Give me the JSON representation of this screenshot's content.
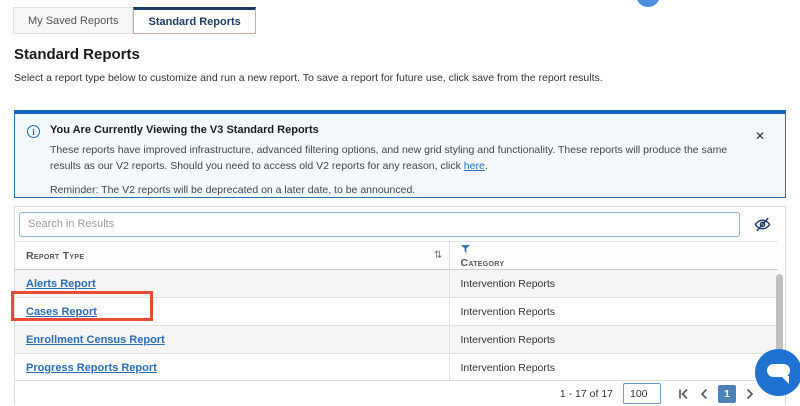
{
  "tabs": [
    {
      "label": "My Saved Reports",
      "active": false
    },
    {
      "label": "Standard Reports",
      "active": true
    }
  ],
  "heading": "Standard Reports",
  "description": "Select a report type below to customize and run a new report. To save a report for future use, click save from the report results.",
  "banner": {
    "title": "You Are Currently Viewing the V3 Standard Reports",
    "body_start": "These reports have improved infrastructure, advanced filtering options, and new grid styling and functionality. These reports will produce the same results as our V2 reports. Should you need to access old V2 reports for any reason, click ",
    "link_text": "here",
    "body_end": ".",
    "reminder": "Reminder: The V2 reports will be deprecated on a later date, to be announced.",
    "close_glyph": "✕"
  },
  "search": {
    "placeholder": "Search in Results"
  },
  "table": {
    "columns": [
      "Report Type",
      "Category"
    ],
    "sort_glyph": "⇅",
    "rows": [
      {
        "report_type": "Alerts Report",
        "category": "Intervention Reports"
      },
      {
        "report_type": "Cases Report",
        "category": "Intervention Reports",
        "highlighted": true
      },
      {
        "report_type": "Enrollment Census Report",
        "category": "Intervention Reports"
      },
      {
        "report_type": "Progress Reports Report",
        "category": "Intervention Reports"
      }
    ]
  },
  "pagination": {
    "range_text": "1 - 17 of 17",
    "page_size": "100",
    "current_page": "1"
  },
  "colors": {
    "navy": "#1e3c64",
    "link_blue": "#2a6db8",
    "banner_border": "#2273b8",
    "banner_top": "#1565c0",
    "highlight_red": "#e84b33",
    "current_page_bg": "#4d82b8",
    "chat_blue": "#1f72d1",
    "stripe_gray": "#f5f5f5"
  }
}
